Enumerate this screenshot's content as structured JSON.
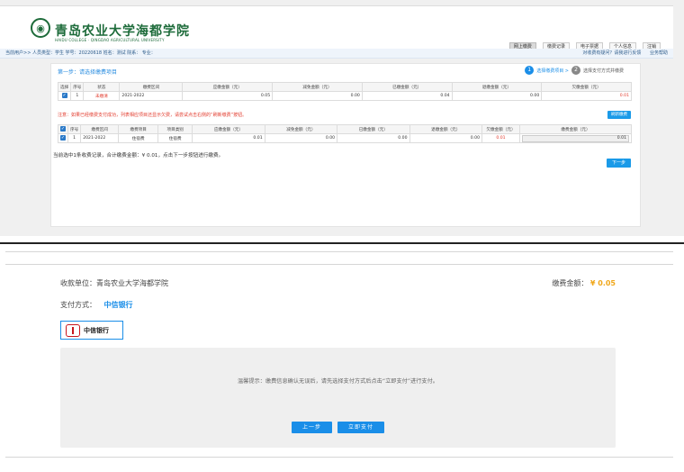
{
  "header": {
    "logo_cn": "青岛农业大学海都学院",
    "logo_en": "HAIDU COLLEGE · QINGDAO AGRICULTURAL UNIVERSITY",
    "nav": [
      "网上缴费",
      "缴费记录",
      "电子票据",
      "个人信息",
      "注销"
    ]
  },
  "infobar": {
    "left": "当前用户>>  人员类型：学生    学号：20220618    姓名：测试    院系：    专业：",
    "right_feedback": "对收费有疑问？请我进行反馈",
    "right_help": "业务帮助"
  },
  "step": {
    "title": "第一步：请选择缴费项目",
    "steps": [
      {
        "num": "1",
        "label": "选择缴费项目 >"
      },
      {
        "num": "2",
        "label": "选择支付方式并缴费"
      }
    ]
  },
  "table1": {
    "headers": [
      "选择",
      "序号",
      "状态",
      "缴费区间",
      "应缴金额（元）",
      "减免金额（元）",
      "已缴金额（元）",
      "退缴金额（元）",
      "欠缴金额（元）"
    ],
    "row": [
      "",
      "1",
      "未缴清",
      "2021-2022",
      "0.05",
      "0.00",
      "0.04",
      "0.00",
      "0.01"
    ]
  },
  "notice": "注意：如果已经缴费支付成功，列表相应项目还显示欠费，请尝试点击右侧的“刷新缴费”按钮。",
  "refresh_label": "刷新缴费",
  "table2": {
    "headers": [
      "",
      "序号",
      "缴费区间",
      "缴费项目",
      "项目类别",
      "应缴金额（元）",
      "减免金额（元）",
      "已缴金额（元）",
      "退缴金额（元）",
      "欠缴金额（元）",
      "缴费金额（元）"
    ],
    "row": [
      "",
      "1",
      "2021-2022",
      "住宿费",
      "住宿费",
      "0.01",
      "0.00",
      "0.00",
      "0.00",
      "0.01",
      "0.01"
    ]
  },
  "summary": "当前选中1条收费记录，合计缴费金额：¥ 0.01，点击下一步按钮进行缴费。",
  "next_label": "下一步",
  "payment": {
    "unit": "收款单位：青岛农业大学海都学院",
    "amount_label": "缴费金额：",
    "amount_value": "¥ 0.05",
    "method_label": "支付方式：",
    "method_value": "中信银行",
    "bank_name": "中信银行",
    "tip": "温馨提示：缴费信息确认无误后，请先选择支付方式后点击“立即支付”进行支付。",
    "prev_label": "上一步",
    "pay_label": "立即支付"
  },
  "colors": {
    "accent": "#1a8ee8",
    "red": "#e23a2c",
    "gold": "#f0a71a",
    "brand_green": "#1d6b3a"
  }
}
